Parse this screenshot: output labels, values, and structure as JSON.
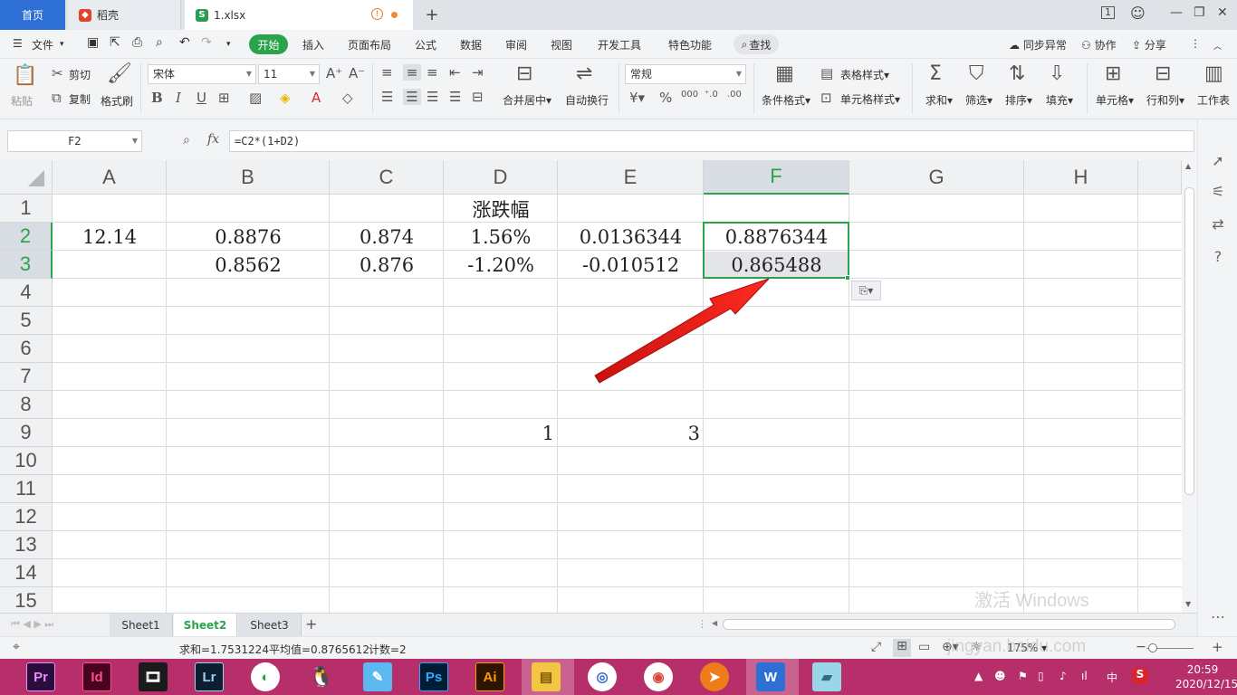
{
  "tabs": {
    "home": "首页",
    "doc": "稻壳",
    "file": "1.xlsx",
    "add": "+"
  },
  "menu": {
    "file": "文件",
    "items": [
      "开始",
      "插入",
      "页面布局",
      "公式",
      "数据",
      "审阅",
      "视图",
      "开发工具",
      "特色功能"
    ],
    "search": "查找",
    "sync": "同步异常",
    "collab": "协作",
    "share": "分享"
  },
  "toolbar": {
    "paste": "粘贴",
    "cut": "剪切",
    "copy": "复制",
    "format_painter": "格式刷",
    "font_name": "宋体",
    "font_size": "11",
    "merge_center": "合并居中",
    "wrap_text": "自动换行",
    "number_format": "常规",
    "conditional_format": "条件格式",
    "table_style": "表格样式",
    "cell_style": "单元格样式",
    "sum": "求和",
    "filter": "筛选",
    "sort": "排序",
    "fill": "填充",
    "cell": "单元格",
    "row_col": "行和列",
    "worksheet": "工作表"
  },
  "formula": {
    "name_box": "F2",
    "formula": "=C2*(1+D2)"
  },
  "columns": [
    "A",
    "B",
    "C",
    "D",
    "E",
    "F",
    "G",
    "H"
  ],
  "rows": [
    "1",
    "2",
    "3",
    "4",
    "5",
    "6",
    "7",
    "8",
    "9",
    "10",
    "11",
    "12",
    "13",
    "14",
    "15"
  ],
  "cells": {
    "D1": "涨跌幅",
    "A2": "12.14",
    "B2": "0.8876",
    "C2": "0.874",
    "D2": "1.56%",
    "E2": "0.0136344",
    "F2": "0.8876344",
    "B3": "0.8562",
    "C3": "0.876",
    "D3": "-1.20%",
    "E3": "-0.010512",
    "F3": "0.865488",
    "D9": "1",
    "E9": "3"
  },
  "sheets": [
    "Sheet1",
    "Sheet2",
    "Sheet3"
  ],
  "active_sheet": "Sheet2",
  "status": {
    "sum": "求和=1.7531224",
    "average": "平均值=0.8765612",
    "count": "计数=2",
    "zoom": "175%"
  },
  "taskbar": {
    "apps": [
      "Pr",
      "Id",
      "",
      "Lr",
      "",
      "",
      "",
      "Ps",
      "Ai"
    ],
    "ime": "中",
    "time": "20:59",
    "date": "2020/12/15"
  },
  "watermark": {
    "activate": "激活 Windows",
    "site": "jingyan.baidu.com"
  },
  "colors": {
    "accent": "#2aa34a",
    "home_tab": "#2e6fd6",
    "taskbar": "#b62e6a",
    "arrow": "#e3201b"
  }
}
